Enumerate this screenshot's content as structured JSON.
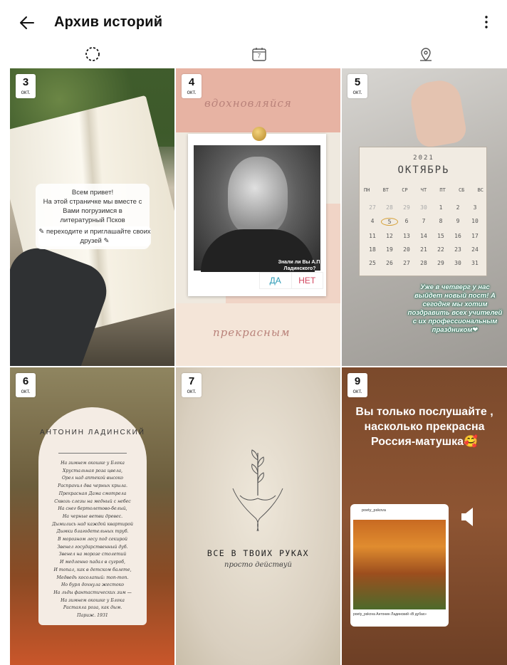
{
  "header": {
    "title": "Архив историй"
  },
  "colors": {
    "accent": "#2d9bb6",
    "danger": "#d2455e",
    "text": "#111111"
  },
  "icons": {
    "back": "arrow-left-icon",
    "title_dropdown": "chevron-down-icon",
    "more": "more-vertical-icon",
    "tab_stories": "stories-ring-icon",
    "tab_calendar": "calendar-icon",
    "tab_map": "map-pin-icon"
  },
  "tabs": {
    "calendar_day": "7"
  },
  "stories": [
    {
      "day": "3",
      "month": "окт.",
      "text": "Всем привет!\nНа этой страничке мы вместе с Вами погрузимся в литературный Псков",
      "text2": "✎ переходите и приглашайте своих друзей ✎"
    },
    {
      "day": "4",
      "month": "окт.",
      "script_top": "вдохновляйся",
      "script_bottom": "прекрасным",
      "question": "Знали ли Вы А.П. Ладинского?",
      "poll_yes": "ДА",
      "poll_no": "НЕТ"
    },
    {
      "day": "5",
      "month": "окт.",
      "year": "2021",
      "month_title": "ОКТЯБРЬ",
      "weekdays": [
        "ПН",
        "ВТ",
        "СР",
        "ЧТ",
        "ПТ",
        "СБ",
        "ВС"
      ],
      "days": [
        "27",
        "28",
        "29",
        "30",
        "1",
        "2",
        "3",
        "4",
        "5",
        "6",
        "7",
        "8",
        "9",
        "10",
        "11",
        "12",
        "13",
        "14",
        "15",
        "16",
        "17",
        "18",
        "19",
        "20",
        "21",
        "22",
        "23",
        "24",
        "25",
        "26",
        "27",
        "28",
        "29",
        "30",
        "31"
      ],
      "dim_count": 4,
      "highlight_day": "5",
      "note": "Уже в четверг у нас выйдет новый пост! А сегодня мы хотим поздравить всех учителей с их профессиональным праздником❤"
    },
    {
      "day": "6",
      "month": "окт.",
      "author": "АНТОНИН ЛАДИНСКИЙ",
      "poem": "На зимнем окошке у Блока\nХрустальная роза цвела,\nОрел над аптекой высоко\nРаспрavил два черных крыла.\nПрекрасная Дама смотрела\nСквозь слезы на медный с небес\nНа снег бертолетово-белый,\nНа черные ветви древес.\nДымились над каждой квартирой\nДымки благодетельных труб.\nВ морозном лесу под секирой\nЗвенел государственный дуб.\nЗвенел на морозе столетий\nИ медленно падал в сугроб,\nИ топал, как в детском балете,\nМедведь косолапый: топ-топ.\nНо буря дохнула жестоко\nНа льды фантастических зим —\nНа зимнем окошке у Блока\nРастаяла роза, как дым.\nПариж. 1931"
    },
    {
      "day": "7",
      "month": "окт.",
      "slogan": "ВСЕ В ТВОИХ РУКАХ",
      "slogan2": "просто действуй"
    },
    {
      "day": "9",
      "month": "окт.",
      "text": "Вы только послушайте , насколько прекрасна Россия-матушка🥰",
      "post_user": "poety_pskova",
      "post_caption": "poety_pskova Антонин Ладинский «В дубах»",
      "sound_icon": "speaker-icon"
    }
  ]
}
